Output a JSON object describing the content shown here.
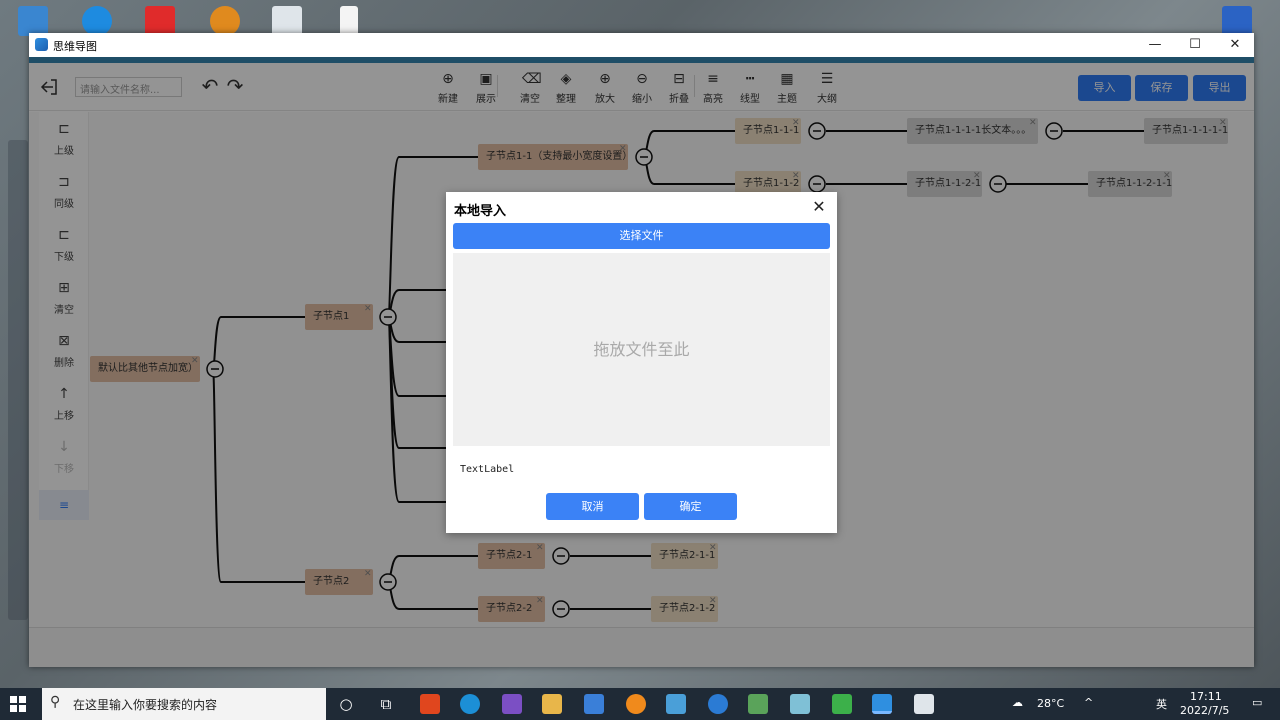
{
  "window": {
    "title": "思维导图",
    "minimize": "—",
    "maximize": "☐",
    "close": "✕"
  },
  "toolbar": {
    "file_placeholder": "请输入文件名称...",
    "tools": [
      {
        "label": "新建",
        "icon": "new-icon",
        "glyph": "⊕"
      },
      {
        "label": "展示",
        "icon": "present-icon",
        "glyph": "▣"
      },
      {
        "label": "清空",
        "icon": "clear-icon",
        "glyph": "⌫"
      },
      {
        "label": "整理",
        "icon": "layers-icon",
        "glyph": "◈"
      },
      {
        "label": "放大",
        "icon": "zoom-in-icon",
        "glyph": "⊕"
      },
      {
        "label": "缩小",
        "icon": "zoom-out-icon",
        "glyph": "⊖"
      },
      {
        "label": "折叠",
        "icon": "collapse-icon",
        "glyph": "⊟"
      },
      {
        "label": "高亮",
        "icon": "highlight-icon",
        "glyph": "≡"
      },
      {
        "label": "线型",
        "icon": "line-style-icon",
        "glyph": "┅"
      },
      {
        "label": "主题",
        "icon": "theme-icon",
        "glyph": "▦"
      },
      {
        "label": "大纲",
        "icon": "outline-icon",
        "glyph": "☰"
      }
    ],
    "import_label": "导入",
    "save_label": "保存",
    "export_label": "导出"
  },
  "sidebar": {
    "items": [
      {
        "label": "上级",
        "icon": "parent-node-icon",
        "glyph": "⊏",
        "disabled": false
      },
      {
        "label": "同级",
        "icon": "sibling-node-icon",
        "glyph": "⊐",
        "disabled": false
      },
      {
        "label": "下级",
        "icon": "child-node-icon",
        "glyph": "⊏",
        "disabled": false
      },
      {
        "label": "清空",
        "icon": "clear-tree-icon",
        "glyph": "⊞",
        "disabled": false
      },
      {
        "label": "删除",
        "icon": "delete-node-icon",
        "glyph": "⊠",
        "disabled": false
      },
      {
        "label": "上移",
        "icon": "move-up-icon",
        "glyph": "↑",
        "disabled": false
      },
      {
        "label": "下移",
        "icon": "move-down-icon",
        "glyph": "↓",
        "disabled": true
      }
    ],
    "toggle_glyph": "≡"
  },
  "mindmap": {
    "nodes": [
      {
        "id": "root",
        "text": "默认比其他节点加宽）",
        "style": "brown"
      },
      {
        "id": "n1",
        "text": "子节点1",
        "style": "brown"
      },
      {
        "id": "n2",
        "text": "子节点2",
        "style": "brown"
      },
      {
        "id": "n11",
        "text": "子节点1-1（支持最小宽度设置）",
        "style": "brown"
      },
      {
        "id": "n111",
        "text": "子节点1-1-1",
        "style": "tan"
      },
      {
        "id": "n112",
        "text": "子节点1-1-2",
        "style": "tan"
      },
      {
        "id": "n1111",
        "text": "子节点1-1-1-1长文本。。。",
        "style": "gray"
      },
      {
        "id": "n11111",
        "text": "子节点1-1-1-1-1",
        "style": "gray"
      },
      {
        "id": "n1121",
        "text": "子节点1-1-2-1",
        "style": "gray"
      },
      {
        "id": "n11211",
        "text": "子节点1-1-2-1-1",
        "style": "gray"
      },
      {
        "id": "n21",
        "text": "子节点2-1",
        "style": "brown"
      },
      {
        "id": "n22",
        "text": "子节点2-2",
        "style": "brown"
      },
      {
        "id": "n211",
        "text": "子节点2-1-1",
        "style": "tan"
      },
      {
        "id": "n221",
        "text": "子节点2-1-2",
        "style": "tan"
      }
    ]
  },
  "dialog": {
    "title": "本地导入",
    "choose_file": "选择文件",
    "drop_hint": "拖放文件至此",
    "text_label": "TextLabel",
    "cancel": "取消",
    "ok": "确定"
  },
  "taskbar": {
    "search_placeholder": "在这里输入你要搜索的内容",
    "weather": "28°C",
    "ime": "英",
    "time": "17:11",
    "date": "2022/7/5"
  },
  "colors": {
    "accent_blue": "#2f7cf6",
    "node_brown": "#e2bea4",
    "node_tan": "#efdfc4",
    "node_gray": "#d8d8d8"
  }
}
